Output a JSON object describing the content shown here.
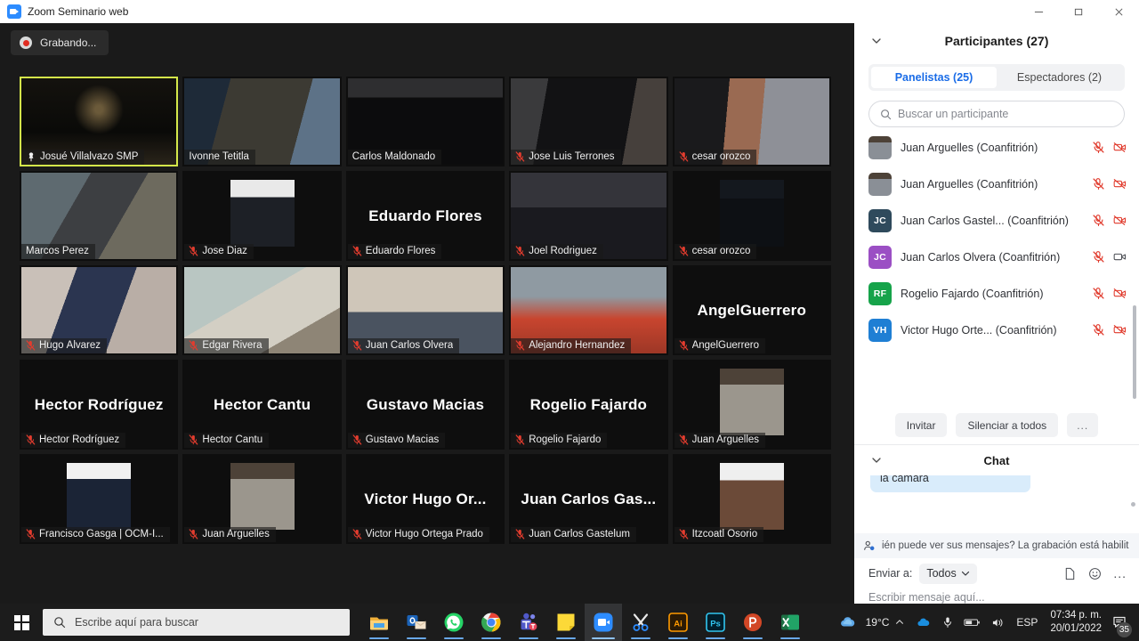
{
  "window": {
    "title": "Zoom Seminario web",
    "app_icon": "zoom-icon",
    "minimize": "minimize-icon",
    "maximize": "maximize-icon",
    "close": "close-icon"
  },
  "meeting": {
    "recording_label": "Grabando...",
    "speaking_border_color": "#d4e84a",
    "tiles": [
      {
        "name": "Josué Villalvazo SMP",
        "muted": false,
        "pinned": true,
        "display": "video",
        "speaking": true,
        "bg": "night-terrace"
      },
      {
        "name": "Ivonne Tetitla",
        "muted": false,
        "pinned": false,
        "display": "video",
        "speaking": false,
        "bg": "room-woman"
      },
      {
        "name": "Carlos Maldonado",
        "muted": false,
        "pinned": false,
        "display": "video",
        "speaking": false,
        "bg": "dark-ceiling"
      },
      {
        "name": "Jose Luis Terrones",
        "muted": true,
        "pinned": false,
        "display": "video",
        "speaking": false,
        "bg": "kitchen-man"
      },
      {
        "name": "cesar orozco",
        "muted": true,
        "pinned": false,
        "display": "video",
        "speaking": false,
        "bg": "brick-worker"
      },
      {
        "name": "Marcos Perez",
        "muted": false,
        "pinned": false,
        "display": "video",
        "speaking": false,
        "bg": "kitchen-chef"
      },
      {
        "name": "Jose Diaz",
        "muted": true,
        "pinned": false,
        "display": "photo",
        "speaking": false,
        "bg": "portrait-suit"
      },
      {
        "name": "Eduardo Flores",
        "muted": true,
        "pinned": false,
        "display": "name",
        "speaking": false,
        "big_name": "Eduardo Flores"
      },
      {
        "name": "Joel Rodriguez",
        "muted": true,
        "pinned": false,
        "display": "video",
        "speaking": false,
        "bg": "office-man"
      },
      {
        "name": "cesar orozco",
        "muted": true,
        "pinned": false,
        "display": "photo",
        "speaking": false,
        "bg": "portrait-dark"
      },
      {
        "name": "Hugo Álvarez",
        "muted": true,
        "pinned": false,
        "display": "video",
        "speaking": false,
        "bg": "indoor-standing"
      },
      {
        "name": "Edgar Rivera",
        "muted": true,
        "pinned": false,
        "display": "video",
        "speaking": false,
        "bg": "pale-room"
      },
      {
        "name": "Juan Carlos Olvera",
        "muted": true,
        "pinned": false,
        "display": "video",
        "speaking": false,
        "bg": "living-room"
      },
      {
        "name": "Alejandro Hernandez",
        "muted": true,
        "pinned": false,
        "display": "video",
        "speaking": false,
        "bg": "headset-apron"
      },
      {
        "name": "AngelGuerrero",
        "muted": true,
        "pinned": false,
        "display": "name",
        "speaking": false,
        "big_name": "AngelGuerrero"
      },
      {
        "name": "Hector Rodríguez",
        "muted": true,
        "pinned": false,
        "display": "name",
        "speaking": false,
        "big_name": "Hector Rodríguez"
      },
      {
        "name": "Hector Cantu",
        "muted": true,
        "pinned": false,
        "display": "name",
        "speaking": false,
        "big_name": "Hector Cantu"
      },
      {
        "name": "Gustavo Macias",
        "muted": true,
        "pinned": false,
        "display": "name",
        "speaking": false,
        "big_name": "Gustavo Macias"
      },
      {
        "name": "Rogelio Fajardo",
        "muted": true,
        "pinned": false,
        "display": "name",
        "speaking": false,
        "big_name": "Rogelio Fajardo"
      },
      {
        "name": "Juan Arguelles",
        "muted": true,
        "pinned": false,
        "display": "photo",
        "speaking": false,
        "bg": "portrait-gray-suit"
      },
      {
        "name": "Francisco Gasga | OCM-I...",
        "muted": true,
        "pinned": false,
        "display": "photo",
        "speaking": false,
        "bg": "portrait-navy"
      },
      {
        "name": "Juan Arguelles",
        "muted": true,
        "pinned": false,
        "display": "photo",
        "speaking": false,
        "bg": "portrait-gray-suit"
      },
      {
        "name": "Victor Hugo Ortega Prado",
        "muted": true,
        "pinned": false,
        "display": "name",
        "speaking": false,
        "big_name": "Victor Hugo Or..."
      },
      {
        "name": "Juan Carlos Gastelum",
        "muted": true,
        "pinned": false,
        "display": "name",
        "speaking": false,
        "big_name": "Juan Carlos Gas..."
      },
      {
        "name": "Itzcoatl Osorio",
        "muted": true,
        "pinned": false,
        "display": "photo",
        "speaking": false,
        "bg": "portrait-brown"
      }
    ]
  },
  "participants": {
    "title": "Participantes (27)",
    "collapse_icon": "chevron-down-icon",
    "tabs": [
      {
        "label": "Panelistas (25)",
        "active": true
      },
      {
        "label": "Espectadores (2)",
        "active": false
      }
    ],
    "search_placeholder": "Buscar un participante",
    "search_value": "",
    "rows": [
      {
        "name": "Juan Arguelles (Coanfitrión)",
        "initials": "",
        "avatar_type": "photo",
        "avatar_color": "#8a8f96",
        "mic": "muted",
        "cam": "off"
      },
      {
        "name": "Juan Arguelles (Coanfitrión)",
        "initials": "",
        "avatar_type": "photo",
        "avatar_color": "#8a8f96",
        "mic": "muted",
        "cam": "off"
      },
      {
        "name": "Juan Carlos Gastel... (Coanfitrión)",
        "initials": "JC",
        "avatar_type": "initials",
        "avatar_color": "#2f4a5c",
        "mic": "muted",
        "cam": "off"
      },
      {
        "name": "Juan Carlos Olvera (Coanfitrión)",
        "initials": "JC",
        "avatar_type": "initials",
        "avatar_color": "#9b4fc4",
        "mic": "muted",
        "cam": "on"
      },
      {
        "name": "Rogelio Fajardo (Coanfitrión)",
        "initials": "RF",
        "avatar_type": "initials",
        "avatar_color": "#16a34a",
        "mic": "muted",
        "cam": "off"
      },
      {
        "name": "Victor Hugo Orte... (Coanfitrión)",
        "initials": "VH",
        "avatar_type": "initials",
        "avatar_color": "#1f7fd4",
        "mic": "muted",
        "cam": "off"
      }
    ],
    "actions": {
      "invite": "Invitar",
      "mute_all": "Silenciar a todos",
      "more": "..."
    }
  },
  "chat": {
    "title": "Chat",
    "collapse_icon": "chevron-down-icon",
    "messages": [
      {
        "text": "la cámara",
        "type": "incoming"
      }
    ],
    "notice": "ién puede ver sus mensajes? La grabación está habilit",
    "notice_icon": "person-privacy-icon",
    "send_to_label": "Enviar a:",
    "send_to_value": "Todos",
    "input_placeholder": "Escribir mensaje aquí...",
    "tools": {
      "file": "file-icon",
      "emoji": "emoji-icon",
      "more": "..."
    }
  },
  "taskbar": {
    "start_icon": "windows-start-icon",
    "search_placeholder": "Escribe aquí para buscar",
    "apps": [
      {
        "name": "file-explorer-icon",
        "label": "Explorador de archivos",
        "active": false
      },
      {
        "name": "outlook-icon",
        "label": "Outlook",
        "active": false
      },
      {
        "name": "whatsapp-icon",
        "label": "WhatsApp",
        "active": false
      },
      {
        "name": "chrome-icon",
        "label": "Google Chrome",
        "active": false
      },
      {
        "name": "teams-icon",
        "label": "Microsoft Teams",
        "active": false
      },
      {
        "name": "sticky-notes-icon",
        "label": "Notas rápidas",
        "active": false
      },
      {
        "name": "zoom-icon",
        "label": "Zoom",
        "active": true
      },
      {
        "name": "snipping-tool-icon",
        "label": "Recortes",
        "active": false
      },
      {
        "name": "illustrator-icon",
        "label": "Adobe Illustrator",
        "active": false
      },
      {
        "name": "photoshop-icon",
        "label": "Adobe Photoshop",
        "active": false
      },
      {
        "name": "powerpoint-icon",
        "label": "PowerPoint",
        "active": false
      },
      {
        "name": "excel-icon",
        "label": "Excel",
        "active": false
      }
    ],
    "tray": {
      "weather_temp": "19°C",
      "weather_icon": "cloud-icon",
      "overflow_icon": "chevron-up-icon",
      "onedrive_icon": "onedrive-icon",
      "mic_icon": "microphone-icon",
      "battery_icon": "battery-icon",
      "volume_icon": "volume-icon",
      "language": "ESP",
      "time": "07:34 p. m.",
      "date": "20/01/2022",
      "notifications_icon": "notifications-icon",
      "notifications_count": "35"
    }
  }
}
